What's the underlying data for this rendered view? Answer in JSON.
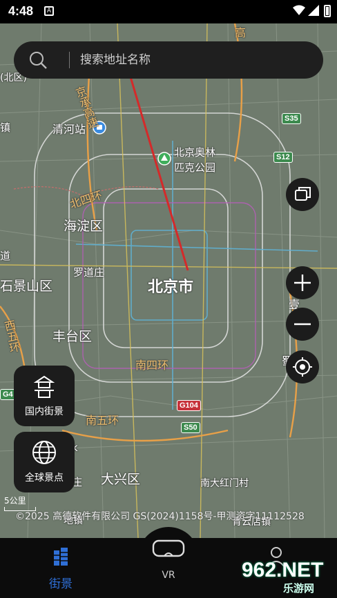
{
  "status_bar": {
    "time": "4:48"
  },
  "search": {
    "placeholder": "搜索地址名称"
  },
  "map": {
    "labels": {
      "beijing_city": "北京市",
      "haidian": "海淀区",
      "shijingshan": "石景山区",
      "fengtai": "丰台区",
      "daxing": "大兴区",
      "luodaozhuang": "罗道庄",
      "qinghe_station": "清河站",
      "olympic_park_line1": "北京奥林",
      "olympic_park_line2": "匹克公园",
      "nandahongmen": "南大红门村",
      "north_4th_ring": "北四环",
      "south_4th_ring": "南四环",
      "south_5th_ring": "南五环",
      "west_5th_ring": "西五环",
      "jingcheng_expy": "京承高速",
      "left_zhen": "镇",
      "left_qu": "区",
      "left_dao": "道",
      "jiading_partial": "(北区)",
      "yizhuang_partial": "亦",
      "right_partial_a": "壹",
      "right_partial_b": "蜀",
      "k_partial": "k",
      "xi_partial": "庄",
      "north_top_partial": "高",
      "bottom_left_partial": "地镇",
      "bottom_right_partial": "青云店镇"
    },
    "shields": {
      "s35": "S35",
      "s12": "S12",
      "g104": "G104",
      "s50": "S50",
      "g4": "G4"
    },
    "scale": "5公里",
    "copyright": "©2025 高德软件有限公司 GS(2024)1158号-甲测资字11112528"
  },
  "controls": {
    "layers_icon": "layers-icon",
    "zoom_in_icon": "plus-icon",
    "zoom_out_icon": "minus-icon",
    "locate_icon": "locate-icon"
  },
  "cards": {
    "domestic_label": "国内街景",
    "global_label": "全球景点"
  },
  "bottom_nav": {
    "street_view_label": "街景",
    "vr_label": "VR",
    "profile_label": ""
  },
  "watermark": {
    "text": "962.NET",
    "sub": "乐游网"
  },
  "colors": {
    "accent_blue": "#2f6fd6",
    "map_bg": "#6f7b6d",
    "road_orange": "#e8a048",
    "annotation_red": "#d42a2a"
  }
}
